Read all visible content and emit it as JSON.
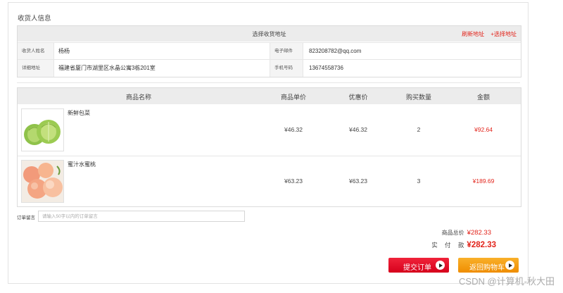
{
  "section_title": "收货人信息",
  "address": {
    "choose_label": "选择收货地址",
    "refresh_link": "刷新地址",
    "select_link": "+选择地址",
    "name_label": "收货人姓名",
    "name_value": "杨杨",
    "email_label": "电子邮件",
    "email_value": "823208782@qq.com",
    "address_label": "详细地址",
    "address_value": "福建省厦门市湖里区水晶公寓3栋201室",
    "phone_label": "手机号码",
    "phone_value": "13674558736"
  },
  "goods": {
    "columns": [
      "商品名称",
      "商品单价",
      "优惠价",
      "购买数量",
      "金额"
    ],
    "items": [
      {
        "name": "新鲜包菜",
        "price": "¥46.32",
        "discount": "¥46.32",
        "qty": "2",
        "amount": "¥92.64",
        "image_icon": "cabbage-image"
      },
      {
        "name": "蜜汁水蜜桃",
        "price": "¥63.23",
        "discount": "¥63.23",
        "qty": "3",
        "amount": "¥189.69",
        "image_icon": "peach-image"
      }
    ]
  },
  "message": {
    "label": "订单留言",
    "placeholder": "请输入50字以内的订单留言"
  },
  "summary": {
    "total_label": "商品总价",
    "total_value": "¥282.33",
    "paid_label": "实 付 款",
    "paid_value": "¥282.33"
  },
  "buttons": {
    "submit": "提交订单",
    "back": "返回购物车"
  },
  "watermark": "CSDN @计算机-秋大田",
  "colors": {
    "accent_red": "#e2231a",
    "submit_red": "#e5132a",
    "back_orange": "#f5a213",
    "header_gray": "#ececec"
  }
}
